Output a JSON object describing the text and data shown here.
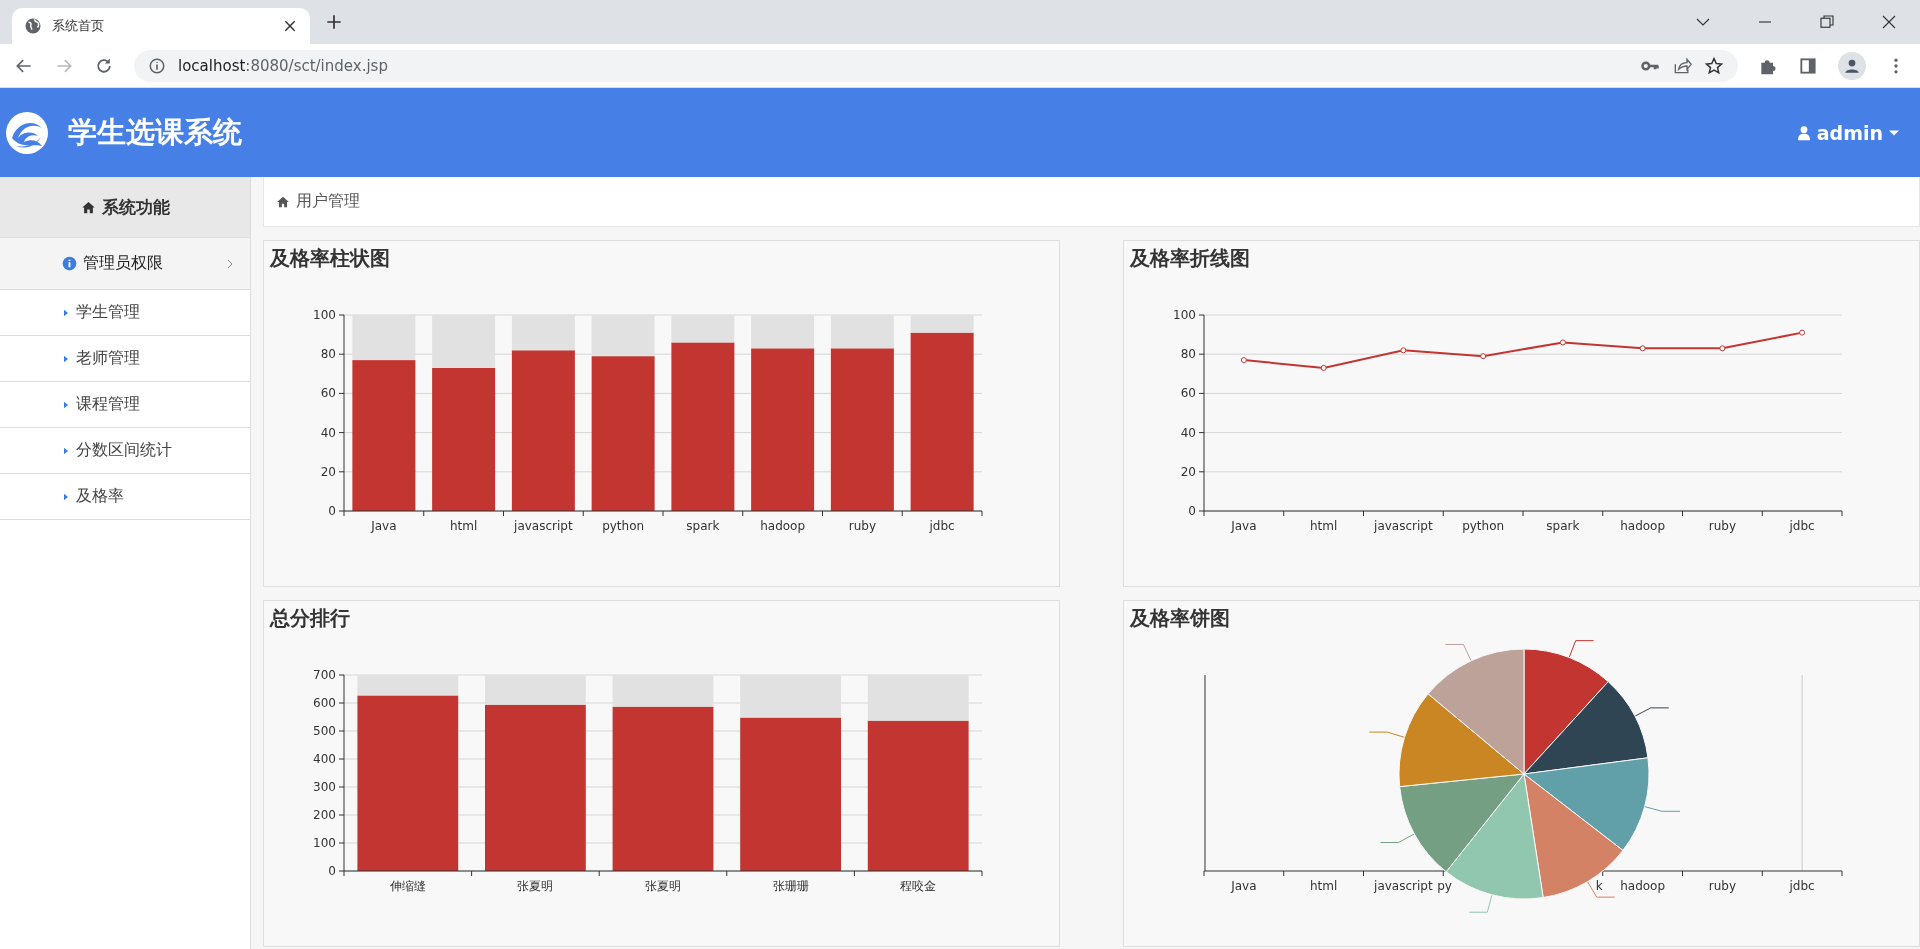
{
  "browser": {
    "tab": {
      "title": "系统首页"
    },
    "url": {
      "host": "localhost",
      "path": ":8080/sct/index.jsp"
    }
  },
  "header": {
    "title": "学生选课系统",
    "user": "admin"
  },
  "sidebar": {
    "title": "系统功能",
    "group": {
      "label": "管理员权限",
      "children": [
        {
          "label": "学生管理"
        },
        {
          "label": "老师管理"
        },
        {
          "label": "课程管理"
        },
        {
          "label": "分数区间统计"
        },
        {
          "label": "及格率"
        }
      ]
    }
  },
  "breadcrumb": "用户管理",
  "panels": [
    {
      "chart_data": {
        "type": "bar",
        "title": "及格率柱状图",
        "categories": [
          "Java",
          "html",
          "javascript",
          "python",
          "spark",
          "hadoop",
          "ruby",
          "jdbc"
        ],
        "series": [
          {
            "color": "#c23531",
            "values": [
              77,
              73,
              82,
              79,
              86,
              83,
              83,
              91
            ]
          },
          {
            "color": "#e1e1e1",
            "values": [
              23,
              27,
              18,
              21,
              14,
              17,
              17,
              9
            ]
          }
        ],
        "stacked": true,
        "ylim": [
          0,
          100
        ],
        "yticks": [
          0,
          20,
          40,
          60,
          80,
          100
        ],
        "grid": true
      }
    },
    {
      "chart_data": {
        "type": "line",
        "title": "及格率折线图",
        "categories": [
          "Java",
          "html",
          "javascript",
          "python",
          "spark",
          "hadoop",
          "ruby",
          "jdbc"
        ],
        "values": [
          77,
          73,
          82,
          79,
          86,
          83,
          83,
          91
        ],
        "ylim": [
          0,
          100
        ],
        "yticks": [
          0,
          20,
          40,
          60,
          80,
          100
        ],
        "grid": true,
        "marker": true
      }
    },
    {
      "chart_data": {
        "type": "bar",
        "title": "总分排行",
        "categories": [
          "伸缩缝",
          "张夏明",
          "张夏明",
          "张珊珊",
          "程咬金"
        ],
        "series": [
          {
            "color": "#c23531",
            "values": [
              627,
              594,
              587,
              548,
              537
            ]
          },
          {
            "color": "#e1e1e1",
            "values": [
              73,
              106,
              113,
              152,
              163
            ]
          }
        ],
        "stacked": true,
        "ylim": [
          0,
          700
        ],
        "yticks": [
          0,
          100,
          200,
          300,
          400,
          500,
          600,
          700
        ],
        "grid": true
      }
    },
    {
      "chart_data": {
        "type": "pie",
        "title": "及格率饼图",
        "values": [
          11.77,
          11.16,
          12.54,
          12.08,
          13.15,
          12.69,
          12.69,
          13.92
        ],
        "colors": [
          "#c23531",
          "#2f4554",
          "#61a0a8",
          "#d48265",
          "#91c7ae",
          "#749f83",
          "#ca8622",
          "#bda29a"
        ]
      },
      "axis_labels": [
        "Java",
        "html",
        "javascript",
        "py",
        "k",
        "hadoop",
        "ruby",
        "jdbc"
      ]
    }
  ]
}
